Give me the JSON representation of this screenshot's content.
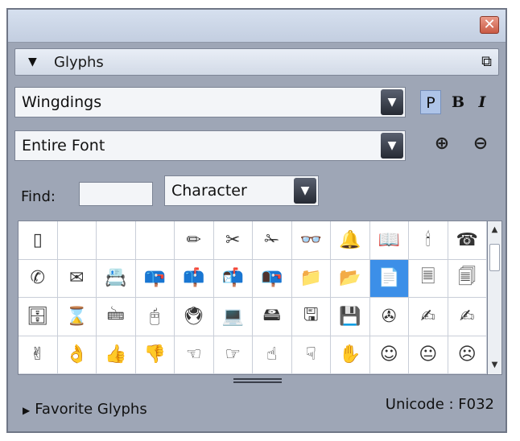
{
  "panel": {
    "close_icon": "close-icon",
    "title": "Glyphs",
    "header_toggle_glyph": "▼",
    "dock_glyph": "⧉"
  },
  "font": {
    "family": "Wingdings",
    "style_plain": "P",
    "style_bold": "B",
    "style_italic": "I",
    "active_style": "P"
  },
  "subset": {
    "value": "Entire Font",
    "zoom_in_glyph": "⊕",
    "zoom_out_glyph": "⊖"
  },
  "find": {
    "label": "Find:",
    "value": "",
    "mode": "Character"
  },
  "grid": {
    "rows": [
      [
        "▯",
        "",
        "",
        "",
        "✏",
        "✂",
        "✁",
        "👓",
        "🔔",
        "📖",
        "🕯",
        "☎"
      ],
      [
        "✆",
        "✉",
        "📇",
        "📪",
        "📫",
        "📬",
        "📭",
        "📁",
        "📂",
        "📄",
        "🗏",
        "🗐"
      ],
      [
        "🗄",
        "⌛",
        "🖮",
        "🖰",
        "🖲",
        "💻",
        "🖴",
        "🖫",
        "💾",
        "✇",
        "✍",
        "✍"
      ],
      [
        "✌",
        "👌",
        "👍",
        "👎",
        "☜",
        "☞",
        "☝",
        "☟",
        "✋",
        "☺",
        "😐",
        "☹"
      ]
    ],
    "selected": {
      "row": 1,
      "col": 9
    }
  },
  "footer": {
    "favorites_glyph": "▶",
    "favorites_label": "Favorite Glyphs",
    "unicode": "Unicode : F032"
  }
}
